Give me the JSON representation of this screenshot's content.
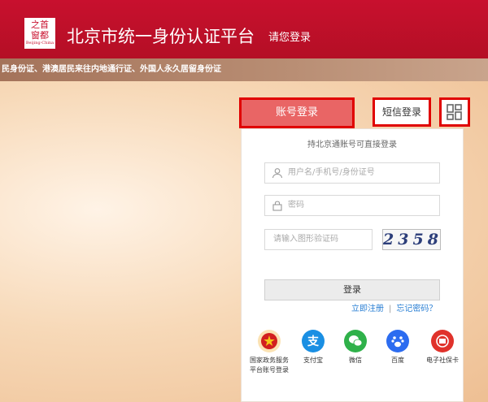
{
  "header": {
    "logo_line1": "之首",
    "logo_line2": "窗都",
    "logo_sub": "Beijing·China",
    "title": "北京市统一身份认证平台",
    "subtitle": "请您登录"
  },
  "notice": "民身份证、港澳居民来往内地通行证、外国人永久居留身份证",
  "tabs": {
    "account": "账号登录",
    "sms": "短信登录"
  },
  "form": {
    "hint": "持北京通账号可直接登录",
    "username_placeholder": "用户名/手机号/身份证号",
    "password_placeholder": "密码",
    "captcha_placeholder": "请输入图形验证码",
    "captcha_text": [
      "2",
      "3",
      "5",
      "8"
    ],
    "login_label": "登录",
    "register_link": "立即注册",
    "forgot_link": "忘记密码？"
  },
  "social": [
    {
      "label": "国家政务服务",
      "label2": "平台账号登录",
      "icon": "national-emblem-icon",
      "color": "#d21f1f"
    },
    {
      "label": "支付宝",
      "label2": "",
      "icon": "alipay-icon",
      "color": "#1a8fe3"
    },
    {
      "label": "微信",
      "label2": "",
      "icon": "wechat-icon",
      "color": "#2fb14a"
    },
    {
      "label": "百度",
      "label2": "",
      "icon": "baidu-icon",
      "color": "#2c6cf0"
    },
    {
      "label": "电子社保卡",
      "label2": "",
      "icon": "social-security-card-icon",
      "color": "#e0322b"
    }
  ],
  "colors": {
    "brand": "#c8102e",
    "tab_active": "#e96565",
    "highlight": "#e00000",
    "link": "#2a7fd4"
  }
}
